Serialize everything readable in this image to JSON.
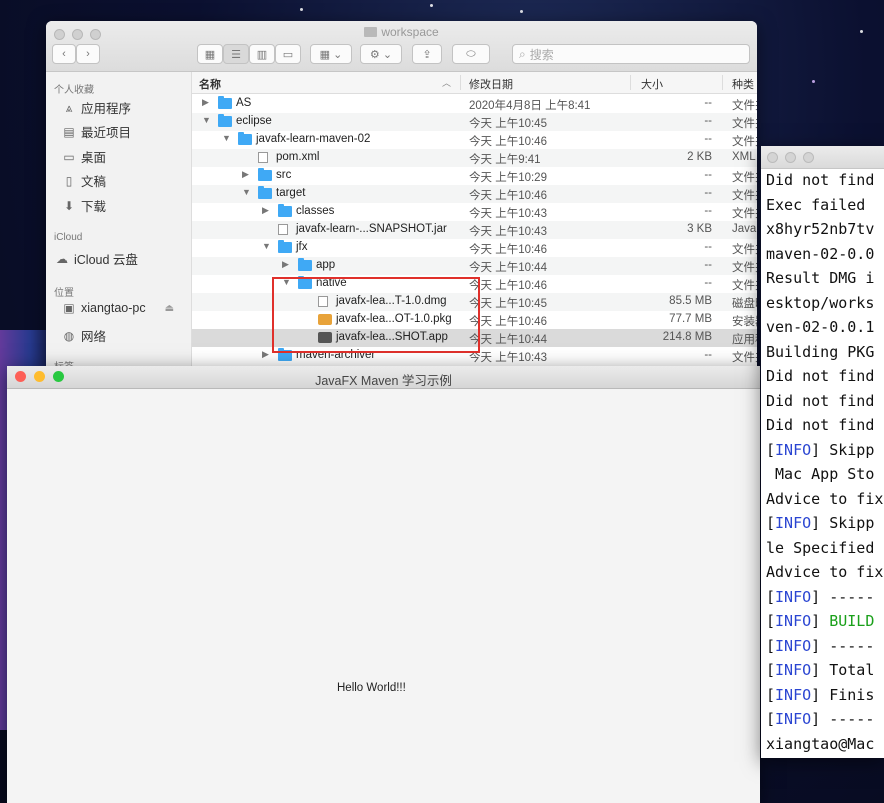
{
  "finder": {
    "title": "workspace",
    "search_placeholder": "搜索",
    "sidebar": {
      "sections": [
        {
          "title": "个人收藏",
          "items": [
            {
              "label": "应用程序",
              "icon": "apps-icon"
            },
            {
              "label": "最近项目",
              "icon": "recents-icon"
            },
            {
              "label": "桌面",
              "icon": "desktop-icon"
            },
            {
              "label": "文稿",
              "icon": "documents-icon"
            },
            {
              "label": "下载",
              "icon": "downloads-icon"
            }
          ]
        },
        {
          "title": "iCloud",
          "items": [
            {
              "label": "iCloud 云盘",
              "icon": "cloud-icon"
            }
          ]
        },
        {
          "title": "位置",
          "items": [
            {
              "label": "xiangtao-pc",
              "icon": "computer-icon"
            },
            {
              "label": "网络",
              "icon": "network-icon"
            }
          ]
        },
        {
          "title": "标签",
          "items": []
        }
      ]
    },
    "columns": {
      "name": "名称",
      "date": "修改日期",
      "size": "大小",
      "kind": "种类"
    },
    "rows": [
      {
        "name": "AS",
        "date": "2020年4月8日 上午8:41",
        "size": "--",
        "kind": "文件夹",
        "type": "folder",
        "depth": 0,
        "disclosure": "closed"
      },
      {
        "name": "eclipse",
        "date": "今天 上午10:45",
        "size": "--",
        "kind": "文件夹",
        "type": "folder",
        "depth": 0,
        "disclosure": "open"
      },
      {
        "name": "javafx-learn-maven-02",
        "date": "今天 上午10:46",
        "size": "--",
        "kind": "文件夹",
        "type": "folder",
        "depth": 1,
        "disclosure": "open"
      },
      {
        "name": "pom.xml",
        "date": "今天 上午9:41",
        "size": "2 KB",
        "kind": "XML",
        "type": "file",
        "depth": 2,
        "disclosure": ""
      },
      {
        "name": "src",
        "date": "今天 上午10:29",
        "size": "--",
        "kind": "文件夹",
        "type": "folder",
        "depth": 2,
        "disclosure": "closed"
      },
      {
        "name": "target",
        "date": "今天 上午10:46",
        "size": "--",
        "kind": "文件夹",
        "type": "folder",
        "depth": 2,
        "disclosure": "open"
      },
      {
        "name": "classes",
        "date": "今天 上午10:43",
        "size": "--",
        "kind": "文件夹",
        "type": "folder",
        "depth": 3,
        "disclosure": "closed"
      },
      {
        "name": "javafx-learn-...SNAPSHOT.jar",
        "date": "今天 上午10:43",
        "size": "3 KB",
        "kind": "Java",
        "type": "file",
        "depth": 3,
        "disclosure": ""
      },
      {
        "name": "jfx",
        "date": "今天 上午10:46",
        "size": "--",
        "kind": "文件夹",
        "type": "folder",
        "depth": 3,
        "disclosure": "open"
      },
      {
        "name": "app",
        "date": "今天 上午10:44",
        "size": "--",
        "kind": "文件夹",
        "type": "folder",
        "depth": 4,
        "disclosure": "closed"
      },
      {
        "name": "native",
        "date": "今天 上午10:46",
        "size": "--",
        "kind": "文件夹",
        "type": "folder",
        "depth": 4,
        "disclosure": "open"
      },
      {
        "name": "javafx-lea...T-1.0.dmg",
        "date": "今天 上午10:45",
        "size": "85.5 MB",
        "kind": "磁盘映像",
        "type": "file",
        "depth": 5,
        "disclosure": ""
      },
      {
        "name": "javafx-lea...OT-1.0.pkg",
        "date": "今天 上午10:46",
        "size": "77.7 MB",
        "kind": "安装器",
        "type": "pkg",
        "depth": 5,
        "disclosure": ""
      },
      {
        "name": "javafx-lea...SHOT.app",
        "date": "今天 上午10:44",
        "size": "214.8 MB",
        "kind": "应用程序",
        "type": "app",
        "depth": 5,
        "disclosure": "",
        "selected": true
      },
      {
        "name": "maven-archiver",
        "date": "今天 上午10:43",
        "size": "--",
        "kind": "文件夹",
        "type": "folder",
        "depth": 3,
        "disclosure": "closed"
      }
    ]
  },
  "fx_window": {
    "title": "JavaFX Maven 学习示例",
    "content_text": "Hello World!!!"
  },
  "terminal": {
    "lines": [
      {
        "text": "Did not find"
      },
      {
        "text": "Exec failed"
      },
      {
        "text": "x8hyr52nb7tv"
      },
      {
        "text": "maven-02-0.0"
      },
      {
        "text": "Result DMG i"
      },
      {
        "text": "esktop/works"
      },
      {
        "text": "ven-02-0.0.1"
      },
      {
        "text": "Building PKG"
      },
      {
        "text": "Did not find"
      },
      {
        "text": "Did not find"
      },
      {
        "text": "Did not find"
      },
      {
        "tag": "INFO",
        "text": " Skipp"
      },
      {
        "text": " Mac App Sto"
      },
      {
        "text": "Advice to fix"
      },
      {
        "tag": "INFO",
        "text": " Skipp"
      },
      {
        "text": "le Specified"
      },
      {
        "text": "Advice to fix"
      },
      {
        "tag": "INFO",
        "text": " -----"
      },
      {
        "tag": "INFO",
        "text": " ",
        "ok": "BUILD"
      },
      {
        "tag": "INFO",
        "text": " -----"
      },
      {
        "tag": "INFO",
        "text": " Total"
      },
      {
        "tag": "INFO",
        "text": " Finis"
      },
      {
        "tag": "INFO",
        "text": " -----"
      },
      {
        "text": "xiangtao@Mac"
      }
    ]
  },
  "colors": {
    "highlight_box": "#e0302b",
    "folder": "#3fa9f5",
    "info_tag": "#2a45d2",
    "build_ok": "#1aa01a"
  }
}
